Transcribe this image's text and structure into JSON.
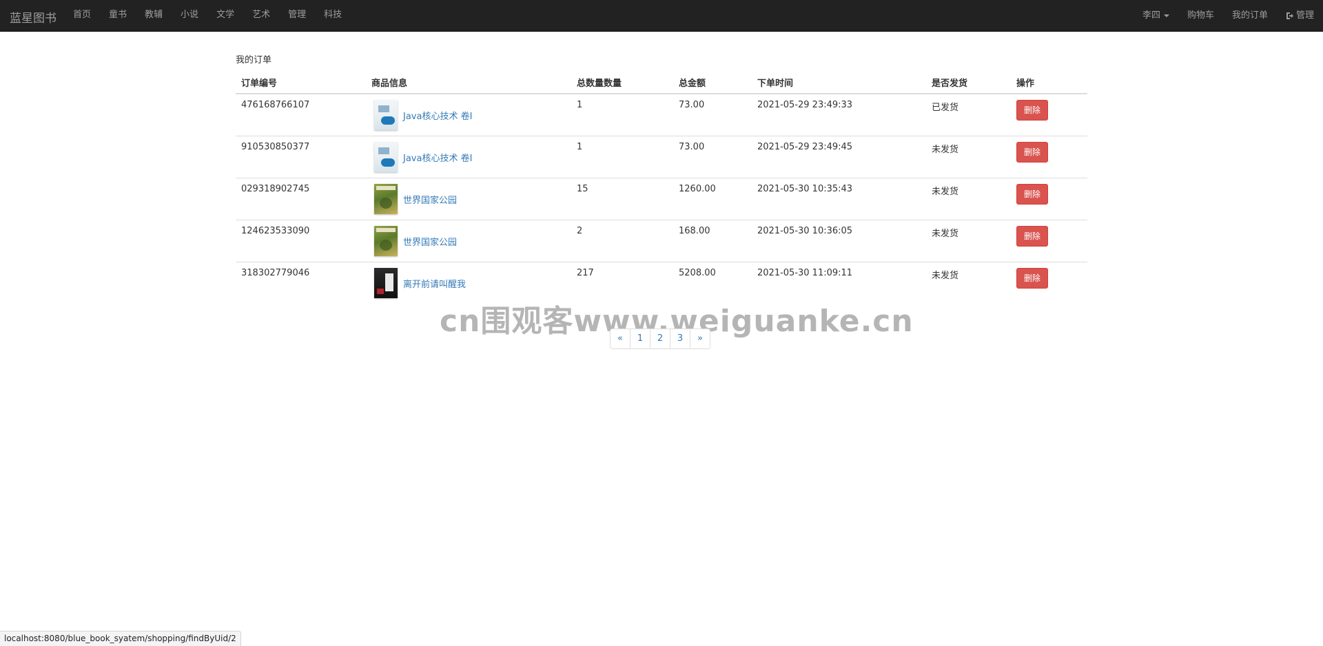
{
  "navbar": {
    "brand": "蓝星图书",
    "left_items": [
      {
        "label": "首页"
      },
      {
        "label": "童书"
      },
      {
        "label": "教辅"
      },
      {
        "label": "小说"
      },
      {
        "label": "文学"
      },
      {
        "label": "艺术"
      },
      {
        "label": "管理"
      },
      {
        "label": "科技"
      }
    ],
    "user": "李四",
    "cart": "购物车",
    "my_orders": "我的订单",
    "admin": "管理",
    "icons": {
      "user_dropdown": "caret-down-icon",
      "admin": "logout-icon"
    }
  },
  "page": {
    "title": "我的订单"
  },
  "table": {
    "headers": [
      "订单编号",
      "商品信息",
      "总数量数量",
      "总金额",
      "下单时间",
      "是否发货",
      "操作"
    ],
    "rows": [
      {
        "order_no": "476168766107",
        "product": "Java核心技术 卷I",
        "cover": "java",
        "quantity": "1",
        "amount": "73.00",
        "time": "2021-05-29 23:49:33",
        "shipped": "已发货",
        "action": "删除"
      },
      {
        "order_no": "910530850377",
        "product": "Java核心技术 卷I",
        "cover": "java",
        "quantity": "1",
        "amount": "73.00",
        "time": "2021-05-29 23:49:45",
        "shipped": "未发货",
        "action": "删除"
      },
      {
        "order_no": "029318902745",
        "product": "世界国家公园",
        "cover": "park",
        "quantity": "15",
        "amount": "1260.00",
        "time": "2021-05-30 10:35:43",
        "shipped": "未发货",
        "action": "删除"
      },
      {
        "order_no": "124623533090",
        "product": "世界国家公园",
        "cover": "park",
        "quantity": "2",
        "amount": "168.00",
        "time": "2021-05-30 10:36:05",
        "shipped": "未发货",
        "action": "删除"
      },
      {
        "order_no": "318302779046",
        "product": "离开前请叫醒我",
        "cover": "dark",
        "quantity": "217",
        "amount": "5208.00",
        "time": "2021-05-30 11:09:11",
        "shipped": "未发货",
        "action": "删除"
      }
    ]
  },
  "pagination": {
    "prev": "«",
    "pages": [
      "1",
      "2",
      "3"
    ],
    "next": "»"
  },
  "watermark": "cn围观客www.weiguanke.cn",
  "status_url": "localhost:8080/blue_book_syatem/shopping/findByUid/2",
  "colors": {
    "navbar_bg": "#222222",
    "link": "#337ab7",
    "danger": "#d9534f"
  }
}
